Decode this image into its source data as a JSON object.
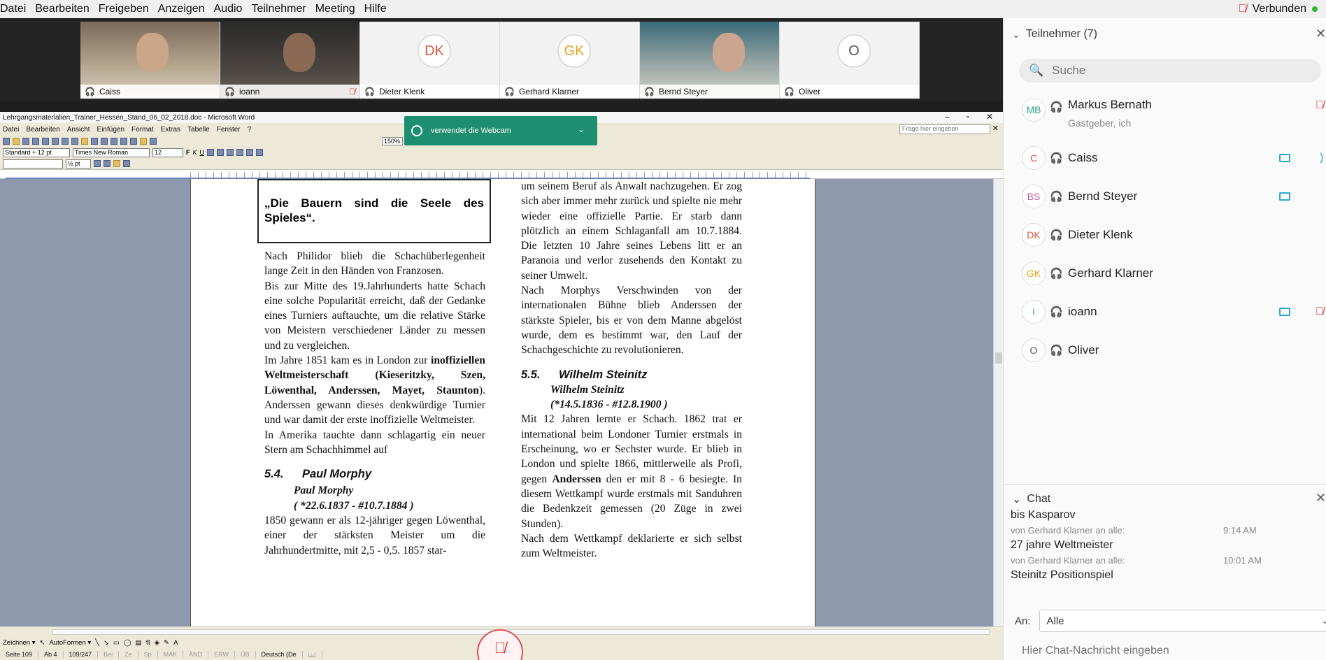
{
  "menubar": {
    "items": [
      "Datei",
      "Bearbeiten",
      "Freigeben",
      "Anzeigen",
      "Audio",
      "Teilnehmer",
      "Meeting",
      "Hilfe"
    ],
    "status": "Verbunden"
  },
  "video_tiles": [
    {
      "name": "Caiss",
      "type": "video"
    },
    {
      "name": "ioann",
      "type": "video"
    },
    {
      "name": "Dieter Klenk",
      "type": "avatar",
      "initials": "DK",
      "color": "#e0533f"
    },
    {
      "name": "Gerhard Klarner",
      "type": "avatar",
      "initials": "GK",
      "color": "#e6a020"
    },
    {
      "name": "Bernd Steyer",
      "type": "video"
    },
    {
      "name": "Oliver",
      "type": "avatar",
      "initials": "O",
      "color": "#555555"
    }
  ],
  "word": {
    "title": "Lehrgangsmaterialien_Trainer_Hessen_Stand_06_02_2018.doc - Microsoft Word",
    "menu": [
      "Datei",
      "Bearbeiten",
      "Ansicht",
      "Einfügen",
      "Format",
      "Extras",
      "Tabelle",
      "Fenster",
      "?"
    ],
    "help_placeholder": "Frage hier eingeben",
    "zoom": "150%",
    "style": "Standard + 12 pt",
    "font": "Times New Roman",
    "size": "12",
    "line_weight": "½ pt",
    "draw_label": "Zeichnen ▾",
    "autoforms_label": "AutoFormen ▾",
    "status": {
      "page": "Seite 109",
      "section": "Ab 4",
      "pages": "109/247",
      "at": "Bei",
      "line": "Ze",
      "col": "Sp",
      "mak": "MAK",
      "aend": "ÄND",
      "erw": "ERW",
      "ub": "ÜB",
      "lang": "Deutsch (De"
    }
  },
  "document": {
    "quote": "„Die Bauern sind die Seele des Spieles“.",
    "left_paras": [
      "Nach Philidor blieb die Schachüberlegenheit lange Zeit in den Händen von Franzosen.",
      "Bis zur Mitte des 19.Jahrhunderts hatte Schach eine solche Popularität erreicht, daß der Gedanke eines Turniers auftauchte, um die relative Stärke von Meistern verschiedener Länder zu messen und zu vergleichen."
    ],
    "left_p3_a": "Im Jahre 1851 kam es in London zur ",
    "left_p3_bold": "inoffiziellen Weltmeisterschaft (Kieseritzky, Szen, Löwenthal, Anderssen, Mayet, Staunton",
    "left_p3_b": "). Anderssen gewann dieses denkwürdige Turnier und war damit der erste inoffizielle Weltmeister.",
    "left_p4": "In Amerika tauchte dann schlagartig ein neuer Stern am Schachhimmel auf",
    "morphy_num": "5.4.",
    "morphy_title": "Paul Morphy",
    "morphy_name": "Paul Morphy",
    "morphy_dates": "( *22.6.1837 - #10.7.1884 )",
    "left_p5": " 1850 gewann er als 12-jähriger gegen Löwenthal, einer der stärksten Meister um die Jahrhundertmitte, mit 2,5 - 0,5. 1857 star-",
    "right_paras": [
      "um seinem Beruf als Anwalt nachzugehen. Er zog sich aber immer mehr zurück und spielte nie mehr wieder eine offizielle Partie. Er starb dann plötzlich an einem Schlaganfall am 10.7.1884. Die letzten 10 Jahre seines Lebens litt er an Paranoia und verlor zusehends den Kontakt zu seiner Umwelt.",
      "Nach Morphys Verschwinden von der internationalen Bühne blieb Anderssen der stärkste Spieler, bis er von dem Manne abgelöst wurde, dem es bestimmt war, den Lauf der Schachgeschichte zu revolutionieren."
    ],
    "steinitz_num": "5.5.",
    "steinitz_title": "Wilhelm Steinitz",
    "steinitz_name": "Wilhelm Steinitz",
    "steinitz_dates": "(*14.5.1836 - #12.8.1900 )",
    "right_p3_a": "Mit 12 Jahren lernte er Schach. 1862 trat er international beim Londoner Turnier erstmals in Erscheinung, wo er Sechster wurde. Er blieb in London und spielte 1866, mittlerweile als Profi, gegen ",
    "right_p3_bold": "Anderssen",
    "right_p3_b": " den er mit 8 - 6 besiegte. In diesem Wettkampf wurde erstmals mit Sanduhren die Bedenkzeit gemessen (20 Züge in zwei Stunden).",
    "right_p4": "Nach dem Wettkampf deklarierte er sich selbst zum Weltmeister."
  },
  "webcam_toast": "verwendet die Webcam",
  "panel": {
    "title": "Teilnehmer (7)",
    "search_placeholder": "Suche",
    "participants": [
      {
        "initials": "MB",
        "name": "Markus Bernath",
        "sub": "Gastgeber, ich",
        "color": "#2aa68a"
      },
      {
        "initials": "C",
        "name": "Caiss",
        "color": "#e0533f"
      },
      {
        "initials": "BS",
        "name": "Bernd Steyer",
        "color": "#c45aa8"
      },
      {
        "initials": "DK",
        "name": "Dieter Klenk",
        "color": "#e0533f"
      },
      {
        "initials": "GK",
        "name": "Gerhard Klarner",
        "color": "#e6a020"
      },
      {
        "initials": "I",
        "name": "ioann",
        "color": "#2aa6d6"
      },
      {
        "initials": "O",
        "name": "Oliver",
        "color": "#555555"
      }
    ]
  },
  "chat": {
    "title": "Chat",
    "messages": [
      {
        "text": "bis Kasparov"
      },
      {
        "meta": "von Gerhard Klarner an alle:",
        "time": "9:14 AM",
        "text": "27 jahre Weltmeister"
      },
      {
        "meta": "von Gerhard Klarner an alle:",
        "time": "10:01 AM",
        "text": "Steinitz Positionspiel"
      }
    ],
    "to_label": "An:",
    "to_value": "Alle",
    "input_placeholder": "Hier Chat-Nachricht eingeben"
  }
}
